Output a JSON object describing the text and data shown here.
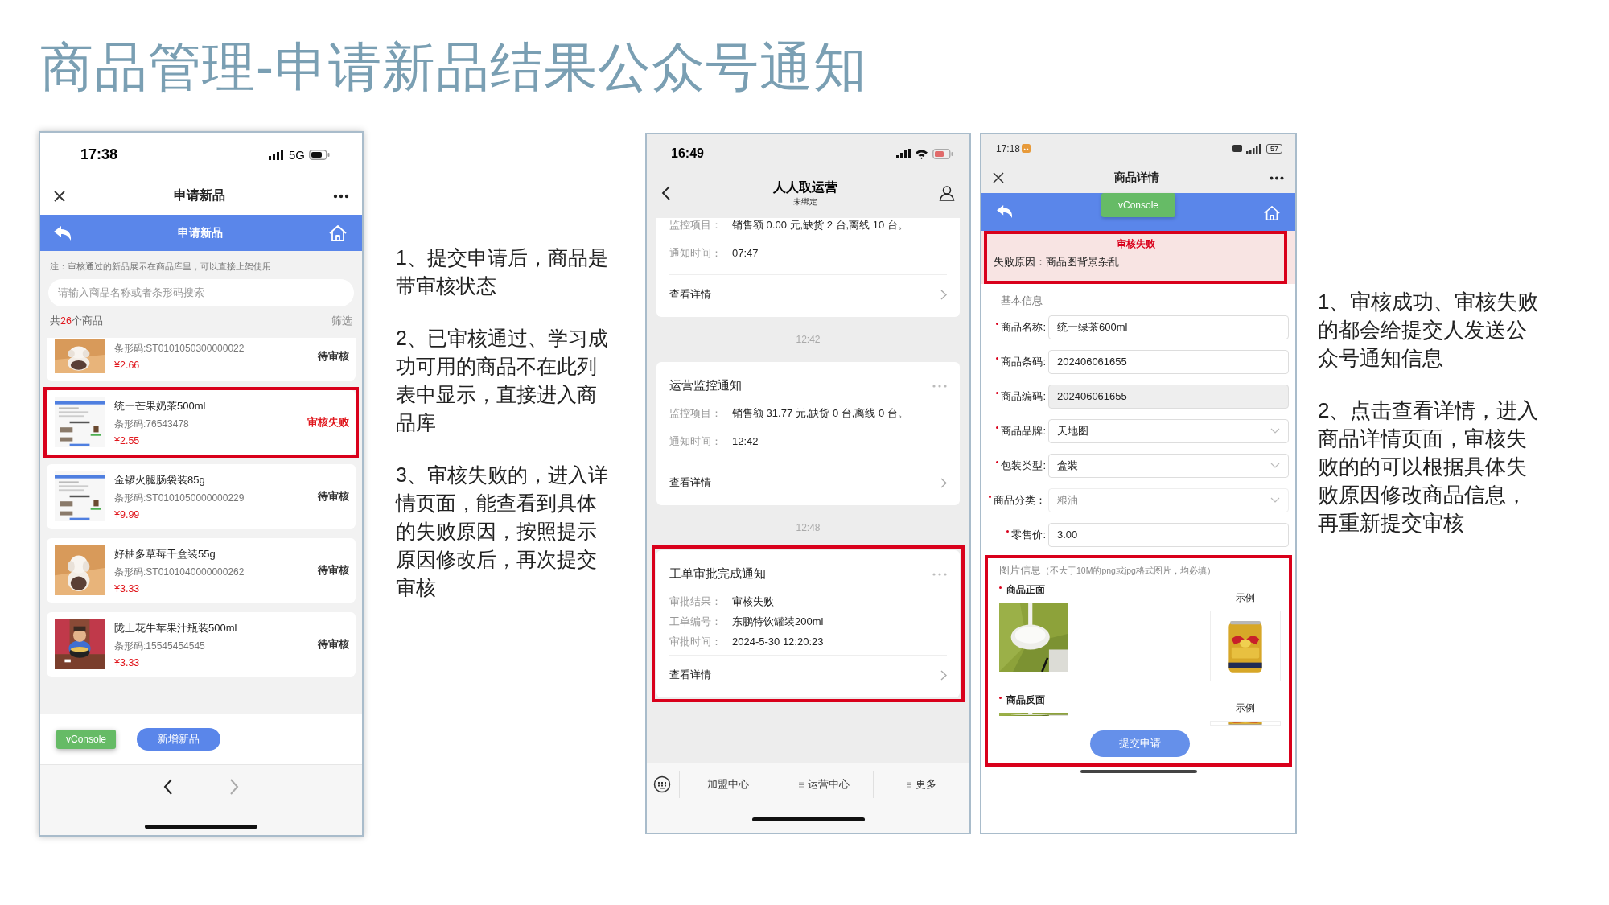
{
  "title": "商品管理-申请新品结果公众号通知",
  "apply_screen": {
    "status_bar": {
      "time": "17:38",
      "network": "5G"
    },
    "nav_title": "申请新品",
    "header_title": "申请新品",
    "notice": "注：审核通过的新品展示在商品库里，可以直接上架使用",
    "search": {
      "placeholder": "请输入商品名称或者条形码搜索"
    },
    "count": {
      "prefix": "共",
      "number": "26",
      "suffix": "个商品"
    },
    "filter": "筛选",
    "products": [
      {
        "barcode": "条形码:ST0101050300000022",
        "price": "¥2.66",
        "status": "待审核",
        "failed": false,
        "highlighted": false
      },
      {
        "name": "统一芒果奶茶500ml",
        "barcode": "条形码:76543478",
        "price": "¥2.55",
        "status": "审核失败",
        "failed": true,
        "highlighted": true
      },
      {
        "name": "金锣火腿肠袋装85g",
        "barcode": "条形码:ST0101050000000229",
        "price": "¥9.99",
        "status": "待审核",
        "failed": false,
        "highlighted": false
      },
      {
        "name": "好柚多草莓干盒装55g",
        "barcode": "条形码:ST0101040000000262",
        "price": "¥3.33",
        "status": "待审核",
        "failed": false,
        "highlighted": false
      },
      {
        "name": "陇上花牛苹果汁瓶装500ml",
        "barcode": "条形码:15545454545",
        "price": "¥3.33",
        "status": "待审核",
        "failed": false,
        "highlighted": false
      }
    ],
    "buttons": [
      {
        "label": "vConsole",
        "kind": "console"
      },
      {
        "label": "新增新品",
        "kind": "primary"
      }
    ]
  },
  "notes_left": [
    "1、提交申请后，商品是带审核状态",
    "2、已审核通过、学习成功可用的商品不在此列表中显示，直接进入商品库",
    "3、审核失败的，进入详情页面，能查看到具体的失败原因，按照提示原因修改后，再次提交审核"
  ],
  "notify_screen": {
    "status_bar": {
      "time": "16:49"
    },
    "nav": {
      "title": "人人取运营",
      "subtitle": "未绑定"
    },
    "messages": [
      {
        "kind": "card",
        "fields": [
          {
            "label": "监控项目：",
            "value": "销售额 0.00 元,缺货 2 台,离线 10 台。"
          },
          {
            "label": "通知时间：",
            "value": "07:47"
          }
        ],
        "link": "查看详情",
        "highlighted": false
      },
      {
        "kind": "time",
        "text": "12:42"
      },
      {
        "kind": "card",
        "title": "运营监控通知",
        "fields": [
          {
            "label": "监控项目：",
            "value": "销售额 31.77 元,缺货 0 台,离线 0 台。"
          },
          {
            "label": "通知时间：",
            "value": "12:42"
          }
        ],
        "link": "查看详情",
        "highlighted": false
      },
      {
        "kind": "time",
        "text": "12:48"
      },
      {
        "kind": "card",
        "title": "工单审批完成通知",
        "fields": [
          {
            "label": "审批结果：",
            "value": "审核失败"
          },
          {
            "label": "工单编号：",
            "value": "东鹏特饮罐装200ml"
          },
          {
            "label": "审批时间：",
            "value": "2024-5-30 12:20:23"
          }
        ],
        "link": "查看详情",
        "highlighted": true
      }
    ],
    "menu": [
      {
        "label": "加盟中心",
        "submenu": false
      },
      {
        "label": "运营中心",
        "submenu": true
      },
      {
        "label": "更多",
        "submenu": true
      }
    ]
  },
  "detail_screen": {
    "status_bar": {
      "time": "17:18",
      "battery": "57"
    },
    "nav_title": "商品详情",
    "console_button": "vConsole",
    "review": {
      "title": "审核失败",
      "reason": "失败原因：商品图背景杂乱",
      "highlighted": true
    },
    "section_title": "基本信息",
    "fields": [
      {
        "label": "商品名称:",
        "value": "统一绿茶600ml",
        "kind": "text",
        "required": true,
        "disabled": false
      },
      {
        "label": "商品条码:",
        "value": "202406061655",
        "kind": "text",
        "required": true,
        "disabled": false
      },
      {
        "label": "商品编码:",
        "value": "202406061655",
        "kind": "readonly",
        "required": true,
        "disabled": false
      },
      {
        "label": "商品品牌:",
        "value": "天地图",
        "kind": "select",
        "required": true,
        "disabled": false
      },
      {
        "label": "包装类型:",
        "value": "盒装",
        "kind": "select",
        "required": true,
        "disabled": false
      },
      {
        "label": "商品分类：",
        "value": "粮油",
        "kind": "select",
        "required": true,
        "disabled": true
      },
      {
        "label": "零售价:",
        "value": "3.00",
        "kind": "text",
        "required": true,
        "disabled": false
      }
    ],
    "photos": {
      "title": "图片信息",
      "hint": "（不大于10M的png或jpg格式图片，均必填）",
      "highlighted": true,
      "rows": [
        {
          "label": "商品正面",
          "example": "示例",
          "required": true
        },
        {
          "label": "商品反面",
          "example": "示例",
          "required": true
        }
      ]
    },
    "submit": "提交申请"
  },
  "notes_right": [
    "1、审核成功、审核失败的都会给提交人发送公众号通知信息",
    "2、点击查看详情，进入商品详情页面，审核失败的的可以根据具体失败原因修改商品信息，再重新提交审核"
  ]
}
